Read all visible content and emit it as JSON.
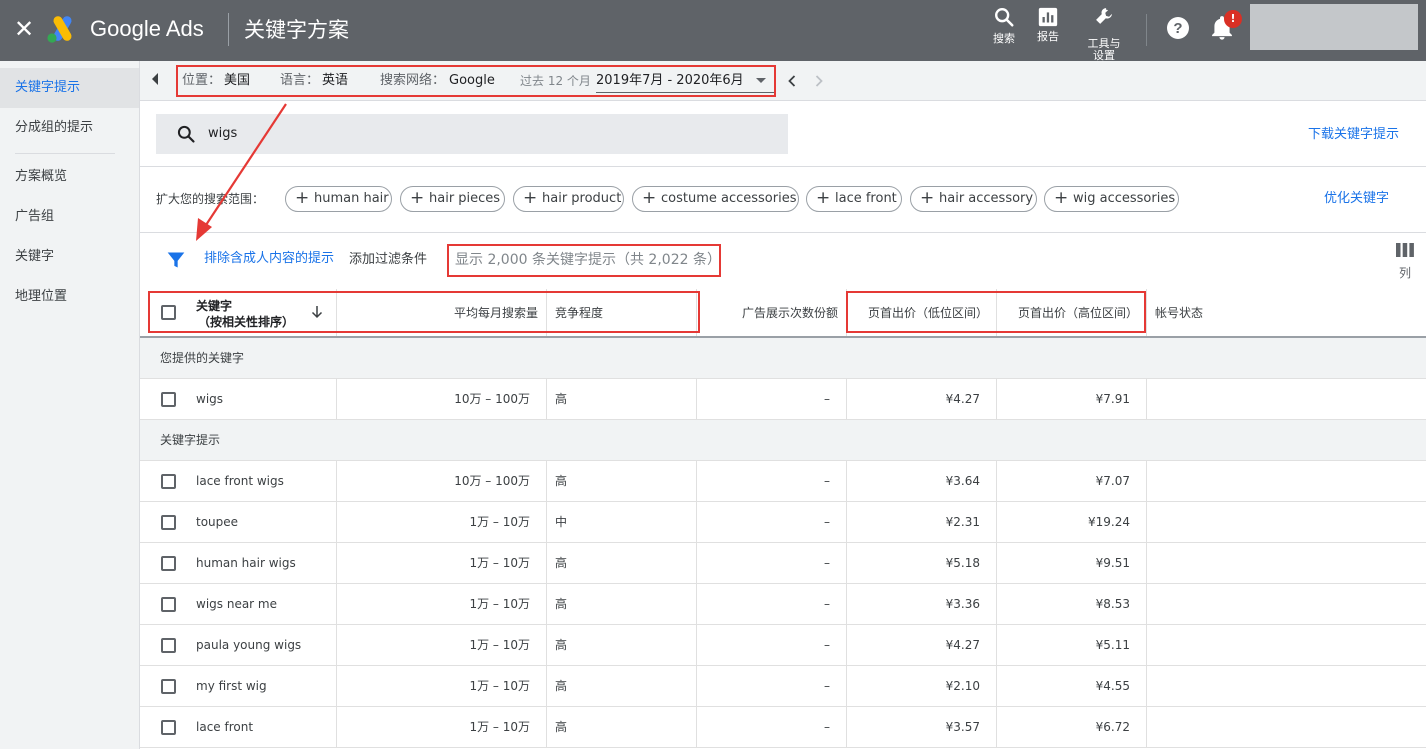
{
  "header": {
    "brand": "Google Ads",
    "page_title": "关键字方案",
    "actions": [
      {
        "id": "search",
        "label": "搜索",
        "icon": "search-icon"
      },
      {
        "id": "reports",
        "label": "报告",
        "icon": "bar-chart-icon"
      },
      {
        "id": "tools",
        "label": "工具与\n设置",
        "icon": "wrench-icon"
      }
    ],
    "notification_badge": "!"
  },
  "sidebar": {
    "items": [
      {
        "label": "关键字提示",
        "active": true
      },
      {
        "label": "分成组的提示",
        "active": false
      },
      {
        "label": "方案概览",
        "active": false
      },
      {
        "label": "广告组",
        "active": false
      },
      {
        "label": "关键字",
        "active": false
      },
      {
        "label": "地理位置",
        "active": false
      }
    ]
  },
  "filter_bar": {
    "location_label": "位置：",
    "location_value": "美国",
    "language_label": "语言：",
    "language_value": "英语",
    "network_label": "搜索网络：",
    "network_value": "Google",
    "range_label": "过去 12 个月",
    "range_value": "2019年7月 - 2020年6月"
  },
  "search": {
    "query": "wigs",
    "download_label": "下载关键字提示"
  },
  "broaden": {
    "label": "扩大您的搜索范围：",
    "chips": [
      "human hair",
      "hair pieces",
      "hair product",
      "costume accessories",
      "lace front",
      "hair accessory",
      "wig accessories"
    ],
    "refine_label": "优化关键字"
  },
  "filters": {
    "exclude_label": "排除含成人内容的提示",
    "add_filter_label": "添加过滤条件",
    "showing_text": "显示 2,000 条关键字提示（共 2,022 条）",
    "columns_label": "列"
  },
  "table": {
    "columns": {
      "keyword_line1": "关键字",
      "keyword_line2": "（按相关性排序）",
      "volume": "平均每月搜索量",
      "competition": "竞争程度",
      "impression_share": "广告展示次数份额",
      "bid_low": "页首出价（低位区间）",
      "bid_high": "页首出价（高位区间）",
      "status": "帐号状态"
    },
    "groups": [
      {
        "title": "您提供的关键字",
        "rows": [
          {
            "keyword": "wigs",
            "volume": "10万 – 100万",
            "competition": "高",
            "share": "–",
            "low": "¥4.27",
            "high": "¥7.91"
          }
        ]
      },
      {
        "title": "关键字提示",
        "rows": [
          {
            "keyword": "lace front wigs",
            "volume": "10万 – 100万",
            "competition": "高",
            "share": "–",
            "low": "¥3.64",
            "high": "¥7.07"
          },
          {
            "keyword": "toupee",
            "volume": "1万 – 10万",
            "competition": "中",
            "share": "–",
            "low": "¥2.31",
            "high": "¥19.24"
          },
          {
            "keyword": "human hair wigs",
            "volume": "1万 – 10万",
            "competition": "高",
            "share": "–",
            "low": "¥5.18",
            "high": "¥9.51"
          },
          {
            "keyword": "wigs near me",
            "volume": "1万 – 10万",
            "competition": "高",
            "share": "–",
            "low": "¥3.36",
            "high": "¥8.53"
          },
          {
            "keyword": "paula young wigs",
            "volume": "1万 – 10万",
            "competition": "高",
            "share": "–",
            "low": "¥4.27",
            "high": "¥5.11"
          },
          {
            "keyword": "my first wig",
            "volume": "1万 – 10万",
            "competition": "高",
            "share": "–",
            "low": "¥2.10",
            "high": "¥4.55"
          },
          {
            "keyword": "lace front",
            "volume": "1万 – 10万",
            "competition": "高",
            "share": "–",
            "low": "¥3.57",
            "high": "¥6.72"
          }
        ]
      }
    ]
  },
  "colors": {
    "header_bg": "#5f6368",
    "accent_blue": "#1a73e8",
    "annotation_red": "#e53935"
  }
}
